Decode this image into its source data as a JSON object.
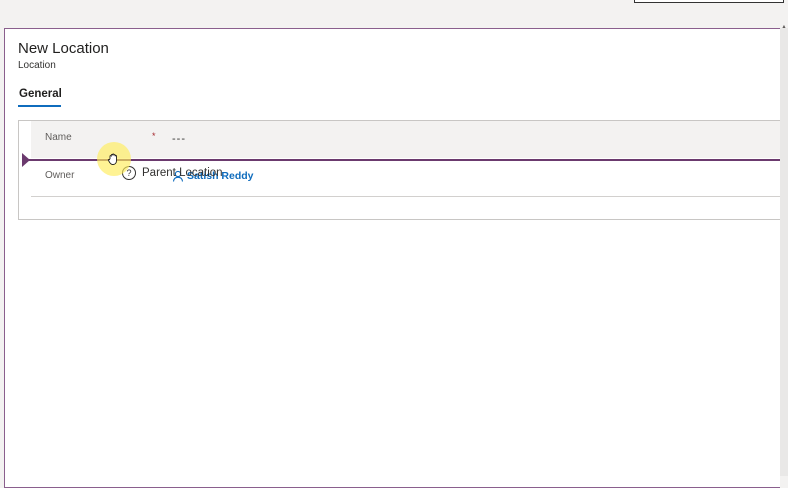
{
  "form": {
    "title": "New Location",
    "subtitle": "Location"
  },
  "tabs": [
    {
      "label": "General",
      "active": true
    }
  ],
  "fields": {
    "name": {
      "label": "Name",
      "required_marker": "*",
      "value": "---"
    },
    "owner": {
      "label": "Owner",
      "value": "Satish Reddy",
      "icon": "person-icon"
    }
  },
  "drag_item": {
    "label": "Parent Location",
    "icon": "help-circle-icon"
  },
  "cursor": {
    "icon": "grab-hand-icon"
  },
  "colors": {
    "accent": "#0f6cbd",
    "frame": "#8a5f8d",
    "drop_indicator": "#6b3a6e",
    "required": "#a4262c",
    "cursor_highlight": "#ffec5a"
  }
}
